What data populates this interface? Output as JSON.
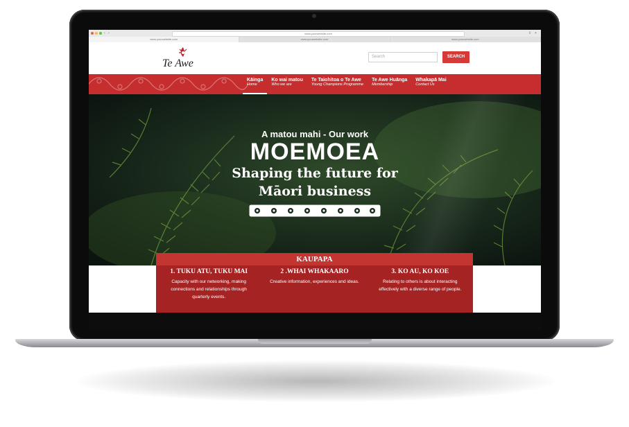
{
  "browser": {
    "url": "www.yourwebsite.com",
    "tabs": [
      "www.yourwebsite.com",
      "www.yourwebsite.com",
      "www.yourwebsite.com"
    ]
  },
  "header": {
    "logo_text": "Te Awe",
    "search_placeholder": "Search",
    "search_button": "SEARCH"
  },
  "nav": {
    "items": [
      {
        "label": "Kāinga",
        "sub": "Home"
      },
      {
        "label": "Ko wai matou",
        "sub": "Who we are"
      },
      {
        "label": "Te Taiohitoa o Te Awe",
        "sub": "Young Champions Programme"
      },
      {
        "label": "Te Awe Huānga",
        "sub": "Membership"
      },
      {
        "label": "Whakapā Mai",
        "sub": "Contact Us"
      }
    ]
  },
  "hero": {
    "kicker": "A matou mahi - Our work",
    "title": "MOEMOEA",
    "subtitle_line1": "Shaping the future for",
    "subtitle_line2": "Māori business"
  },
  "kaupapa": {
    "heading": "KAUPAPA",
    "columns": [
      {
        "title": "1. TUKU ATU, TUKU MAI",
        "text": "Capacity with our networking, making connections and relationships through quarterly events."
      },
      {
        "title": "2 .WHAI WHAKAARO",
        "text": "Creative information, experiences and ideas."
      },
      {
        "title": "3. KO AU, KO KOE",
        "text": "Relating to others is about interacting effectively with a diverse range of people."
      }
    ]
  },
  "colors": {
    "brand_red": "#c52d2e",
    "button_red": "#d63a36",
    "panel_red": "#a52423"
  }
}
